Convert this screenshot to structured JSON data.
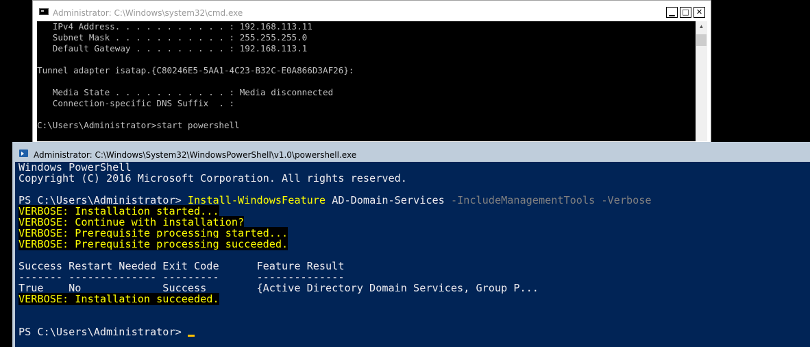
{
  "cmd_window": {
    "title": "Administrator: C:\\Windows\\system32\\cmd.exe",
    "controls": {
      "minimize": "▁",
      "maximize": "□",
      "close": "✕"
    },
    "lines": [
      "   IPv4 Address. . . . . . . . . . . : 192.168.113.11",
      "   Subnet Mask . . . . . . . . . . . : 255.255.255.0",
      "   Default Gateway . . . . . . . . . : 192.168.113.1",
      "",
      "Tunnel adapter isatap.{C80246E5-5AA1-4C23-B32C-E0A866D3AF26}:",
      "",
      "   Media State . . . . . . . . . . . : Media disconnected",
      "   Connection-specific DNS Suffix  . :",
      "",
      "C:\\Users\\Administrator>start powershell"
    ],
    "scroll_up_glyph": "▲"
  },
  "ps_window": {
    "title": "Administrator: C:\\Windows\\System32\\WindowsPowerShell\\v1.0\\powershell.exe",
    "header_lines": [
      "Windows PowerShell",
      "Copyright (C) 2016 Microsoft Corporation. All rights reserved."
    ],
    "prompt": "PS C:\\Users\\Administrator> ",
    "command": {
      "cmdlet": "Install-WindowsFeature",
      "argument": " AD-Domain-Services ",
      "params": "-IncludeManagementTools -Verbose"
    },
    "verbose_lines": [
      "VERBOSE: Installation started...",
      "VERBOSE: Continue with installation?",
      "VERBOSE: Prerequisite processing started...",
      "VERBOSE: Prerequisite processing succeeded."
    ],
    "result_table": {
      "header": "Success Restart Needed Exit Code      Feature Result",
      "separator": "------- -------------- ---------      --------------",
      "row": "True    No             Success        {Active Directory Domain Services, Group P..."
    },
    "final_verbose": "VERBOSE: Installation succeeded.",
    "final_prompt": "PS C:\\Users\\Administrator> ",
    "colors": {
      "background": "#012456",
      "foreground": "#eeedf0",
      "verbose": "#ffff00",
      "parameter": "#808080",
      "cursor": "#ffc000"
    }
  }
}
